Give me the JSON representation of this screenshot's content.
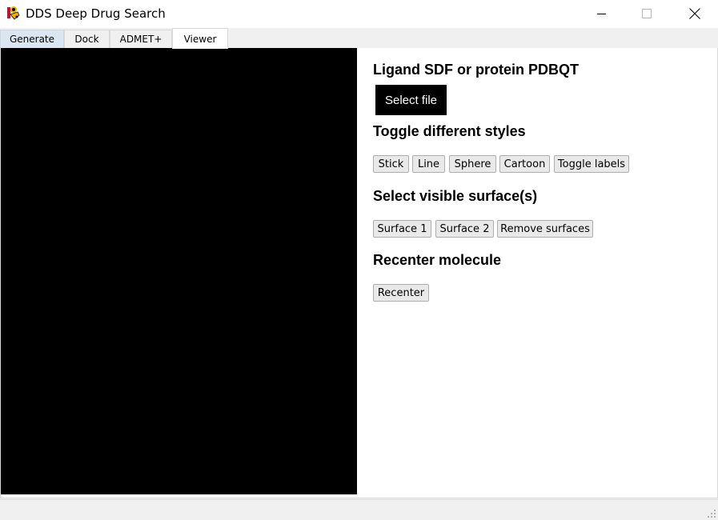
{
  "window": {
    "title": "DDS Deep Drug Search",
    "icons": {
      "app": "app-logo-icon",
      "minimize": "minimize-icon",
      "maximize": "maximize-icon",
      "close": "close-icon"
    }
  },
  "tabs": [
    {
      "label": "Generate"
    },
    {
      "label": "Dock"
    },
    {
      "label": "ADMET+"
    },
    {
      "label": "Viewer"
    }
  ],
  "active_tab": "Viewer",
  "panel": {
    "file_section": {
      "heading": "Ligand SDF or protein PDBQT",
      "select_label": "Select file"
    },
    "styles_section": {
      "heading": "Toggle different styles",
      "buttons": [
        "Stick",
        "Line",
        "Sphere",
        "Cartoon",
        "Toggle labels"
      ]
    },
    "surface_section": {
      "heading": "Select visible surface(s)",
      "buttons": [
        "Surface 1",
        "Surface 2",
        "Remove surfaces"
      ]
    },
    "recenter_section": {
      "heading": "Recenter molecule",
      "button": "Recenter"
    }
  },
  "colors": {
    "viewer_background": "#000000",
    "select_button_bg": "#000000",
    "select_button_text": "#ffffff"
  }
}
